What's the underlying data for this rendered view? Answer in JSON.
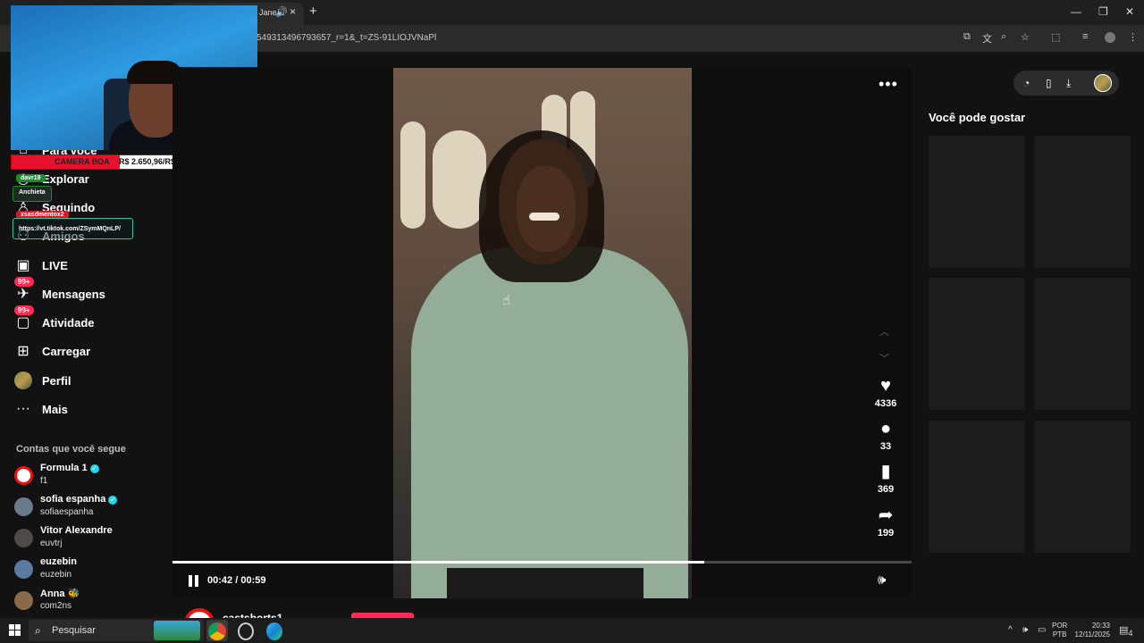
{
  "browser": {
    "tab_title": "Jane",
    "tab_audio_icon": "speaker-icon",
    "tab_close": "×",
    "new_tab": "+",
    "url": "549313496793657_r=1&_t=ZS-91LIOJVNaPl",
    "window_controls": {
      "minimize": "—",
      "restore": "❐",
      "close": "✕"
    }
  },
  "sidebar": {
    "items": [
      {
        "label": "Para você",
        "icon": "home-icon"
      },
      {
        "label": "Explorar",
        "icon": "compass-icon"
      },
      {
        "label": "Seguindo",
        "icon": "following-icon"
      },
      {
        "label": "Amigos",
        "icon": "friends-icon"
      },
      {
        "label": "LIVE",
        "icon": "live-icon"
      },
      {
        "label": "Mensagens",
        "icon": "messages-icon",
        "badge": "99+"
      },
      {
        "label": "Atividade",
        "icon": "activity-icon",
        "badge": "99+"
      },
      {
        "label": "Carregar",
        "icon": "upload-icon"
      },
      {
        "label": "Perfil",
        "icon": "profile-avatar"
      },
      {
        "label": "Mais",
        "icon": "more-icon"
      }
    ],
    "following_title": "Contas que você segue",
    "following": [
      {
        "name": "Formula 1",
        "handle": "f1",
        "verified": true
      },
      {
        "name": "sofia espanha",
        "handle": "sofiaespanha",
        "verified": true
      },
      {
        "name": "Vitor Alexandre",
        "handle": "euvtrj",
        "verified": false
      },
      {
        "name": "euzebin",
        "handle": "euzebin",
        "verified": false
      },
      {
        "name": "Anna 🐝",
        "handle": "com2ns",
        "verified": false
      }
    ]
  },
  "stream_overlay": {
    "donation_label": "CAMERA BOA",
    "donation_value": "R$ 2.650,96/R$ 6.000,00",
    "user_tag_1": "davr19",
    "user_tag_2": "Anchieta",
    "user_tag_3": "xsasdmentox2",
    "link_text": "https://vt.tiktok.com/ZSymMQnLP/"
  },
  "video": {
    "current_time": "00:42",
    "separator": "/",
    "duration": "00:59",
    "progress_fraction": 0.72,
    "likes": "4336",
    "comments": "33",
    "saves": "369",
    "shares": "199",
    "author": "castshorts1"
  },
  "right_panel": {
    "title": "Você pode gostar"
  },
  "taskbar": {
    "search_placeholder": "Pesquisar",
    "lang_1": "POR",
    "lang_2": "PTB",
    "time": "20:33",
    "date": "12/11/2025",
    "notification_count": "4"
  }
}
